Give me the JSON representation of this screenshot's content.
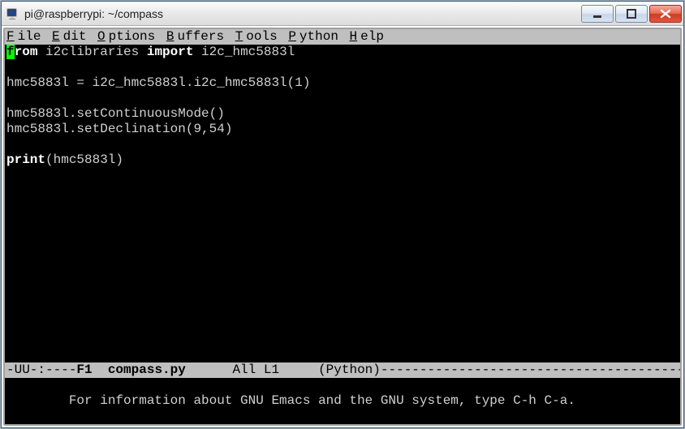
{
  "window": {
    "title": "pi@raspberrypi: ~/compass"
  },
  "menubar": {
    "items": [
      {
        "label": "File",
        "ul": "F"
      },
      {
        "label": "Edit",
        "ul": "E"
      },
      {
        "label": "Options",
        "ul": "O"
      },
      {
        "label": "Buffers",
        "ul": "B"
      },
      {
        "label": "Tools",
        "ul": "T"
      },
      {
        "label": "Python",
        "ul": "P"
      },
      {
        "label": "Help",
        "ul": "H"
      }
    ]
  },
  "editor": {
    "lines": [
      {
        "segments": [
          {
            "t": "f",
            "cls": "cursor kw"
          },
          {
            "t": "rom",
            "cls": "kw"
          },
          {
            "t": " i2clibraries ",
            "cls": "normtxt"
          },
          {
            "t": "import",
            "cls": "kw"
          },
          {
            "t": " i2c_hmc5883l",
            "cls": "normtxt"
          }
        ]
      },
      {
        "segments": [
          {
            "t": " ",
            "cls": "normtxt"
          }
        ]
      },
      {
        "segments": [
          {
            "t": "hmc5883l = i2c_hmc5883l.i2c_hmc5883l(1)",
            "cls": "normtxt"
          }
        ]
      },
      {
        "segments": [
          {
            "t": " ",
            "cls": "normtxt"
          }
        ]
      },
      {
        "segments": [
          {
            "t": "hmc5883l.setContinuousMode()",
            "cls": "normtxt"
          }
        ]
      },
      {
        "segments": [
          {
            "t": "hmc5883l.setDeclination(9,54)",
            "cls": "normtxt"
          }
        ]
      },
      {
        "segments": [
          {
            "t": " ",
            "cls": "normtxt"
          }
        ]
      },
      {
        "segments": [
          {
            "t": "print",
            "cls": "kw"
          },
          {
            "t": "(hmc5883l)",
            "cls": "normtxt"
          }
        ]
      }
    ]
  },
  "modeline": {
    "left": "-UU-:----",
    "frame": "F1",
    "buffer": "compass.py",
    "pos": "All L1",
    "mode": "(Python)",
    "dashes": "----------------------------------------------"
  },
  "minibuffer": {
    "text": "For information about GNU Emacs and the GNU system, type C-h C-a."
  }
}
